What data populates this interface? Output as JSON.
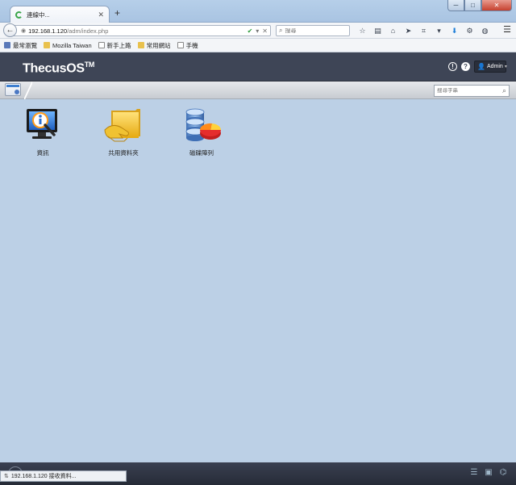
{
  "browser": {
    "tab": {
      "title": "連線中..."
    },
    "window_controls": {
      "minimize": "─",
      "maximize": "□",
      "close": "✕"
    },
    "url": {
      "host": "192.168.1.120",
      "path": "/adm/index.php"
    },
    "search": {
      "placeholder": "搜尋"
    },
    "bookmarks": [
      {
        "label": "最常瀏覽",
        "icon": "gear-icon"
      },
      {
        "label": "Mozilla Taiwan",
        "icon": "folder-icon"
      },
      {
        "label": "新手上路",
        "icon": "page-icon"
      },
      {
        "label": "常用網站",
        "icon": "folder-icon"
      },
      {
        "label": "手機",
        "icon": "page-icon"
      }
    ],
    "status_text": "192.168.1.120 接收資料..."
  },
  "os": {
    "logo": "ThecusOS",
    "logo_tm": "TM",
    "user": "Admin",
    "search_placeholder": "搜尋字串",
    "apps": [
      {
        "label": "資訊",
        "icon": "info-monitor-icon"
      },
      {
        "label": "共用資料夾",
        "icon": "shared-folder-icon"
      },
      {
        "label": "磁碟陣列",
        "icon": "disk-array-icon"
      }
    ]
  },
  "colors": {
    "header_bg": "#3e4556",
    "desktop_bg": "#bcd0e6",
    "taskbar_bg": "#2f3544"
  }
}
